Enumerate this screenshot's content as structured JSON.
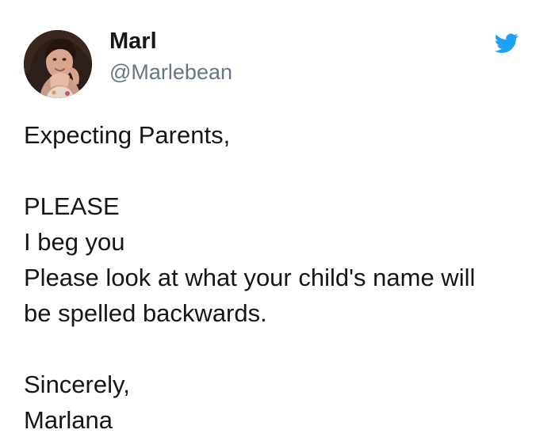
{
  "user": {
    "display_name": "Marl",
    "handle": "@Marlebean"
  },
  "icons": {
    "avatar": "profile-photo",
    "brand": "twitter-bird-icon"
  },
  "tweet": {
    "lines": [
      "Expecting Parents,",
      "",
      "PLEASE",
      "I beg you",
      "Please look at what your child's name will",
      "be spelled backwards.",
      "",
      "Sincerely,",
      "Marlana"
    ]
  },
  "colors": {
    "brand_blue": "#1da1f2",
    "text_primary": "#14171a",
    "text_secondary": "#657786",
    "background": "#ffffff"
  }
}
